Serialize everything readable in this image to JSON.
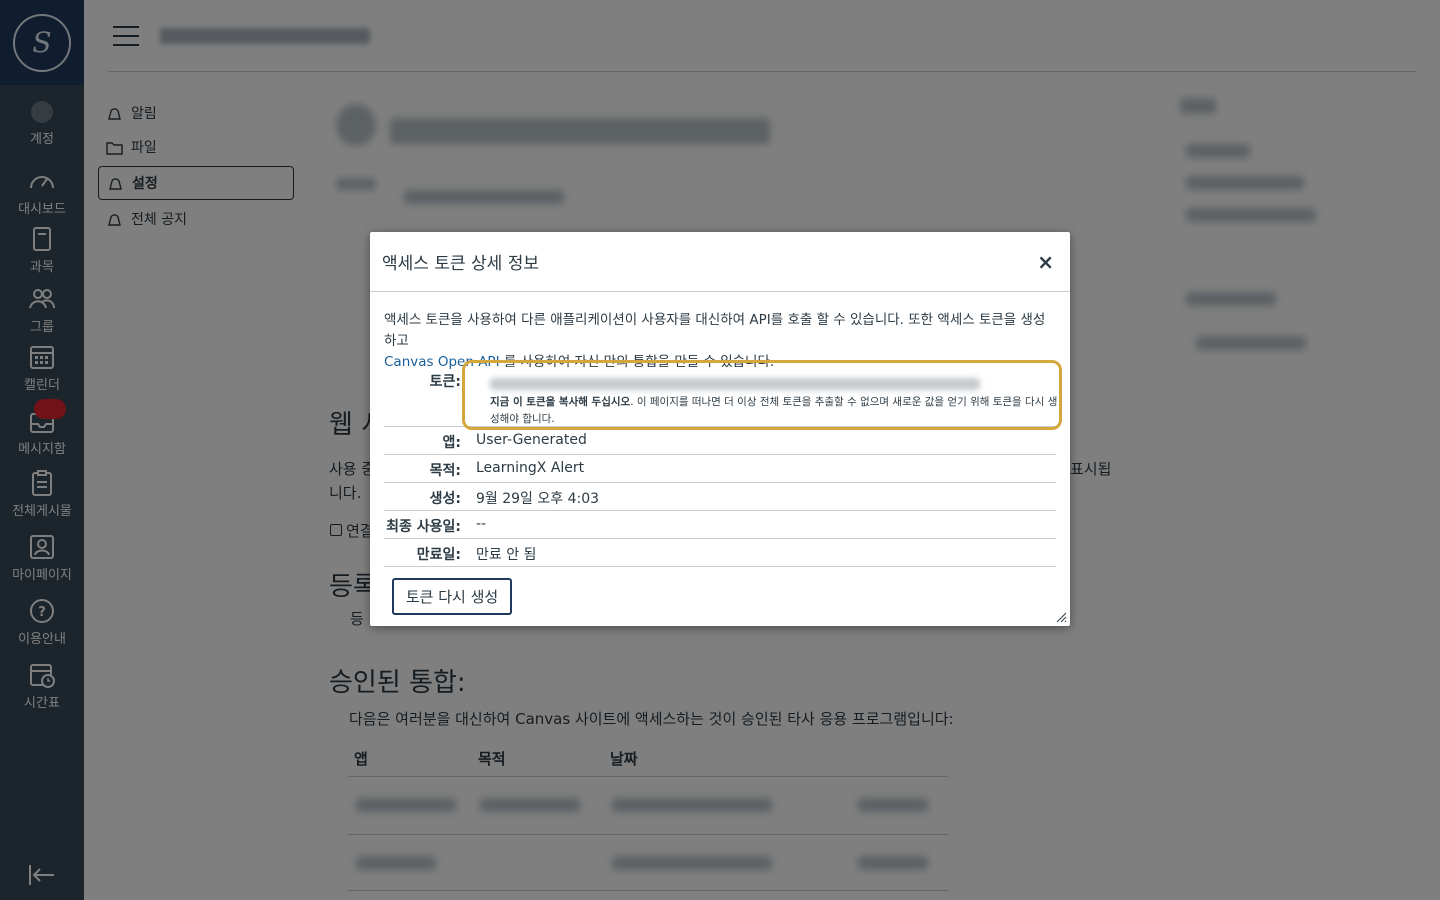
{
  "nav": {
    "items": [
      {
        "label": "계정",
        "icon": "account-icon"
      },
      {
        "label": "대시보드",
        "icon": "dashboard-icon"
      },
      {
        "label": "과목",
        "icon": "courses-icon"
      },
      {
        "label": "그룹",
        "icon": "groups-icon"
      },
      {
        "label": "캘린더",
        "icon": "calendar-icon"
      },
      {
        "label": "메시지함",
        "icon": "inbox-icon"
      },
      {
        "label": "전체게시물",
        "icon": "board-icon"
      },
      {
        "label": "마이페이지",
        "icon": "mypage-icon"
      },
      {
        "label": "이용안내",
        "icon": "help-icon"
      },
      {
        "label": "시간표",
        "icon": "timetable-icon"
      }
    ]
  },
  "section_nav": {
    "items": [
      {
        "label": "알림"
      },
      {
        "label": "파일"
      },
      {
        "label": "설정"
      },
      {
        "label": "전체 공지"
      }
    ]
  },
  "background": {
    "web_services_heading_fragment": "웹 서",
    "usage_text_fragment": "사용 중",
    "usage_text_fragment2": "니다.",
    "usage_text_right": "표시됩",
    "connect_checkbox_label": "연결",
    "registered_heading_fragment": "등록",
    "registered_text_fragment": "등",
    "approved_heading": "승인된 통합:",
    "approved_desc": "다음은 여러분을 대신하여 Canvas 사이트에 액세스하는 것이 승인된 타사 응용 프로그램입니다:",
    "table_headers": [
      "앱",
      "목적",
      "날짜"
    ]
  },
  "modal": {
    "title": "액세스 토큰 상세 정보",
    "close": "×",
    "desc_line1": "액세스 토큰을 사용하여 다른 애플리케이션이 사용자를 대신하여 API를 호출 할 수 있습니다. 또한 액세스 토큰을 생성하고",
    "desc_link": "Canvas Open API",
    "desc_line2": " 를 사용하여 자신 만의 통합을 만들 수 있습니다.",
    "token_label": "토큰:",
    "token_note_bold": "지금 이 토큰을 복사해 두십시오",
    "token_note_rest": ". 이 페이지를 떠나면 더 이상 전체 토큰을 추출할 수 없으며 새로운 값을 얻기 위해 토큰을 다시 생성해야 합니다.",
    "rows": [
      {
        "label": "앱:",
        "value": "User-Generated"
      },
      {
        "label": "목적:",
        "value": "LearningX Alert"
      },
      {
        "label": "생성:",
        "value": "9월 29일 오후 4:03"
      },
      {
        "label": "최종 사용일:",
        "value": "--"
      },
      {
        "label": "만료일:",
        "value": "만료 안 됨"
      }
    ],
    "regenerate_button": "토큰 다시 생성"
  },
  "colors": {
    "nav_bg": "#394b58",
    "logo_bg": "#1f3a5c",
    "highlight": "#d4a73a",
    "link": "#1a5f9b"
  }
}
